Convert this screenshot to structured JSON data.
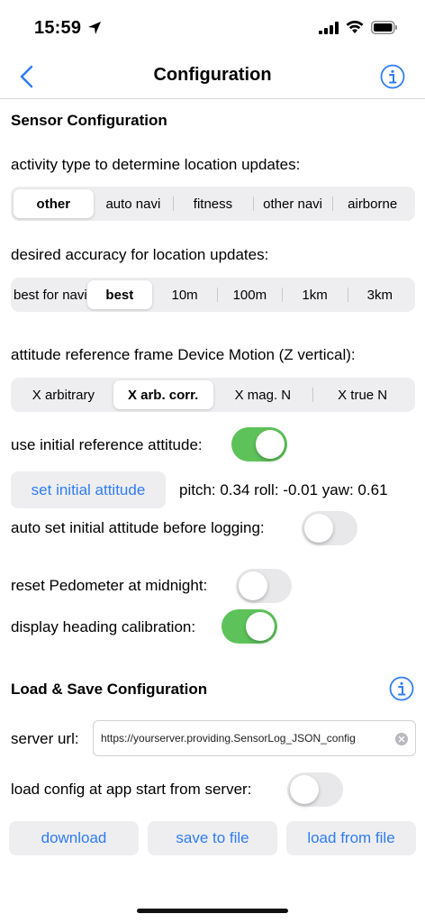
{
  "status": {
    "time": "15:59"
  },
  "nav": {
    "title": "Configuration"
  },
  "sensor": {
    "section_title": "Sensor Configuration",
    "activity_label": "activity type to determine location updates:",
    "activity_options": [
      "other",
      "auto navi",
      "fitness",
      "other navi",
      "airborne"
    ],
    "activity_selected": "other",
    "accuracy_label": "desired accuracy for location updates:",
    "accuracy_options": [
      "best for navi",
      "best",
      "10m",
      "100m",
      "1km",
      "3km"
    ],
    "accuracy_selected": "best",
    "attitude_label": "attitude reference frame Device Motion (Z vertical):",
    "attitude_options": [
      "X arbitrary",
      "X arb. corr.",
      "X mag. N",
      "X true N"
    ],
    "attitude_selected": "X arb. corr.",
    "use_initial_label": "use initial reference attitude:",
    "use_initial_on": true,
    "set_initial_button": "set initial attitude",
    "attitude_readout": "pitch: 0.34 roll: -0.01 yaw: 0.61",
    "auto_set_label": "auto set initial attitude before logging:",
    "auto_set_on": false,
    "reset_pedometer_label": "reset Pedometer at midnight:",
    "reset_pedometer_on": false,
    "heading_label": "display heading calibration:",
    "heading_on": true
  },
  "load_save": {
    "section_title": "Load & Save Configuration",
    "server_label": "server url:",
    "server_url": "https://yourserver.providing.SensorLog_JSON_config",
    "load_at_start_label": "load config at app start from server:",
    "load_at_start_on": false,
    "download_button": "download",
    "save_button": "save to file",
    "load_button": "load from file"
  },
  "colors": {
    "accent": "#2f7cf6",
    "toggle_on": "#5ec25a",
    "segment_bg": "#eeeef0"
  }
}
